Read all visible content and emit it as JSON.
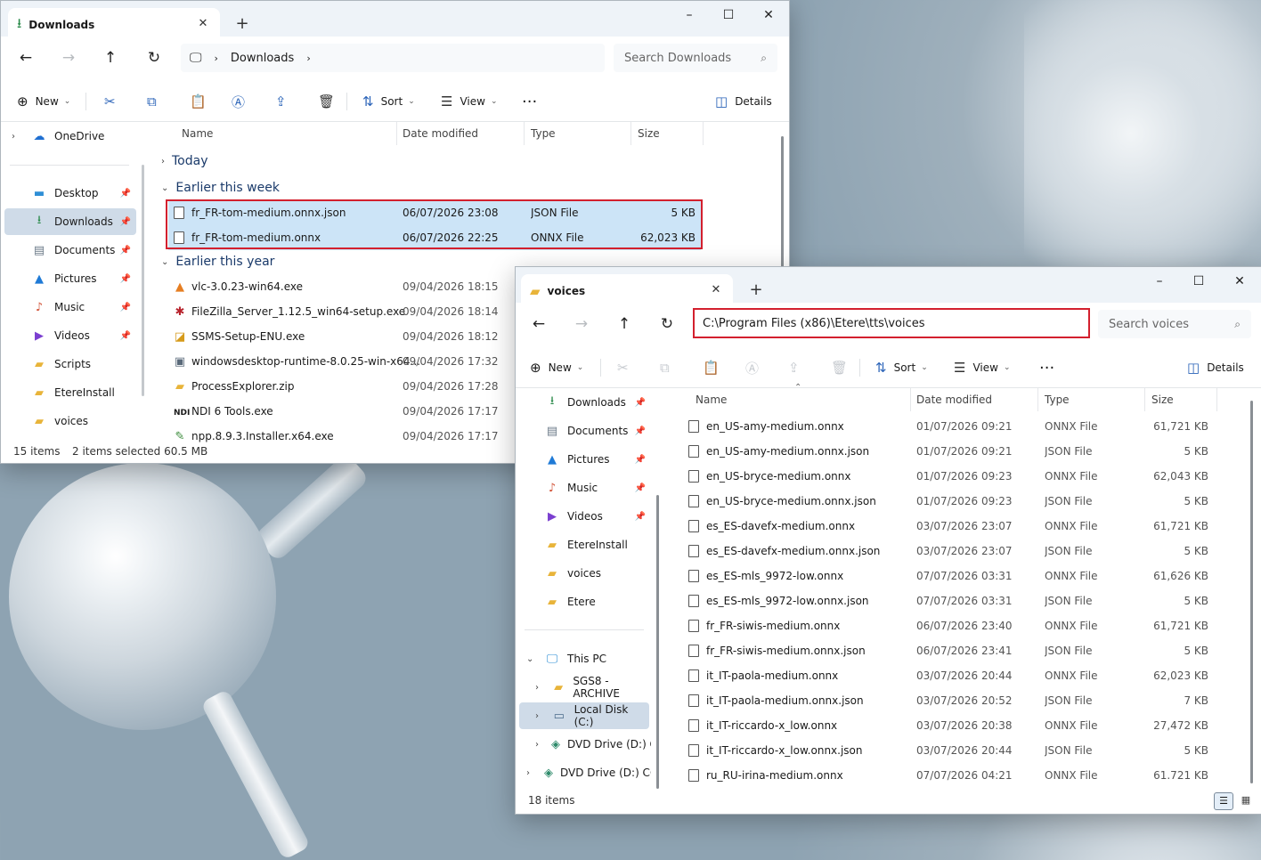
{
  "colors": {
    "highlight": "#d3202e",
    "selected_row": "#cce4f7",
    "accent": "#2a63b8"
  },
  "win1": {
    "tab_title": "Downloads",
    "breadcrumb": [
      "Downloads"
    ],
    "search_placeholder": "Search Downloads",
    "cmd": {
      "new": "New",
      "sort": "Sort",
      "view": "View",
      "details": "Details"
    },
    "nav": {
      "onedrive": "OneDrive",
      "items": [
        "Desktop",
        "Downloads",
        "Documents",
        "Pictures",
        "Music",
        "Videos",
        "Scripts",
        "EtereInstall",
        "voices"
      ]
    },
    "columns": {
      "name": "Name",
      "date": "Date modified",
      "type": "Type",
      "size": "Size"
    },
    "groups": {
      "today": "Today",
      "week": "Earlier this week",
      "year": "Earlier this year"
    },
    "week_files": [
      {
        "name": "fr_FR-tom-medium.onnx.json",
        "date": "06/07/2026 23:08",
        "type": "JSON File",
        "size": "5 KB"
      },
      {
        "name": "fr_FR-tom-medium.onnx",
        "date": "06/07/2026 22:25",
        "type": "ONNX File",
        "size": "62,023 KB"
      }
    ],
    "year_files": [
      {
        "name": "vlc-3.0.23-win64.exe",
        "date": "09/04/2026 18:15"
      },
      {
        "name": "FileZilla_Server_1.12.5_win64-setup.exe",
        "date": "09/04/2026 18:14"
      },
      {
        "name": "SSMS-Setup-ENU.exe",
        "date": "09/04/2026 18:12"
      },
      {
        "name": "windowsdesktop-runtime-8.0.25-win-x64...",
        "date": "09/04/2026 17:32"
      },
      {
        "name": "ProcessExplorer.zip",
        "date": "09/04/2026 17:28"
      },
      {
        "name": "NDI 6 Tools.exe",
        "date": "09/04/2026 17:17"
      },
      {
        "name": "npp.8.9.3.Installer.x64.exe",
        "date": "09/04/2026 17:17"
      }
    ],
    "status": {
      "count": "15 items",
      "selected": "2 items selected  60.5 MB"
    }
  },
  "win2": {
    "tab_title": "voices",
    "address": "C:\\Program Files (x86)\\Etere\\tts\\voices",
    "search_placeholder": "Search voices",
    "cmd": {
      "new": "New",
      "sort": "Sort",
      "view": "View",
      "details": "Details"
    },
    "nav": {
      "items": [
        "Downloads",
        "Documents",
        "Pictures",
        "Music",
        "Videos",
        "EtereInstall",
        "voices",
        "Etere"
      ],
      "thispc": "This PC",
      "drives": [
        "SGS8 - ARCHIVE",
        "Local Disk (C:)",
        "DVD Drive (D:) CC",
        "DVD Drive (D:) CCC"
      ]
    },
    "columns": {
      "name": "Name",
      "date": "Date modified",
      "type": "Type",
      "size": "Size"
    },
    "files": [
      {
        "name": "en_US-amy-medium.onnx",
        "date": "01/07/2026 09:21",
        "type": "ONNX File",
        "size": "61,721 KB"
      },
      {
        "name": "en_US-amy-medium.onnx.json",
        "date": "01/07/2026 09:21",
        "type": "JSON File",
        "size": "5 KB"
      },
      {
        "name": "en_US-bryce-medium.onnx",
        "date": "01/07/2026 09:23",
        "type": "ONNX File",
        "size": "62,043 KB"
      },
      {
        "name": "en_US-bryce-medium.onnx.json",
        "date": "01/07/2026 09:23",
        "type": "JSON File",
        "size": "5 KB"
      },
      {
        "name": "es_ES-davefx-medium.onnx",
        "date": "03/07/2026 23:07",
        "type": "ONNX File",
        "size": "61,721 KB"
      },
      {
        "name": "es_ES-davefx-medium.onnx.json",
        "date": "03/07/2026 23:07",
        "type": "JSON File",
        "size": "5 KB"
      },
      {
        "name": "es_ES-mls_9972-low.onnx",
        "date": "07/07/2026 03:31",
        "type": "ONNX File",
        "size": "61,626 KB"
      },
      {
        "name": "es_ES-mls_9972-low.onnx.json",
        "date": "07/07/2026 03:31",
        "type": "JSON File",
        "size": "5 KB"
      },
      {
        "name": "fr_FR-siwis-medium.onnx",
        "date": "06/07/2026 23:40",
        "type": "ONNX File",
        "size": "61,721 KB"
      },
      {
        "name": "fr_FR-siwis-medium.onnx.json",
        "date": "06/07/2026 23:41",
        "type": "JSON File",
        "size": "5 KB"
      },
      {
        "name": "it_IT-paola-medium.onnx",
        "date": "03/07/2026 20:44",
        "type": "ONNX File",
        "size": "62,023 KB"
      },
      {
        "name": "it_IT-paola-medium.onnx.json",
        "date": "03/07/2026 20:52",
        "type": "JSON File",
        "size": "7 KB"
      },
      {
        "name": "it_IT-riccardo-x_low.onnx",
        "date": "03/07/2026 20:38",
        "type": "ONNX File",
        "size": "27,472 KB"
      },
      {
        "name": "it_IT-riccardo-x_low.onnx.json",
        "date": "03/07/2026 20:44",
        "type": "JSON File",
        "size": "5 KB"
      },
      {
        "name": "ru_RU-irina-medium.onnx",
        "date": "07/07/2026 04:21",
        "type": "ONNX File",
        "size": "61.721 KB"
      }
    ],
    "status": {
      "count": "18 items"
    }
  }
}
